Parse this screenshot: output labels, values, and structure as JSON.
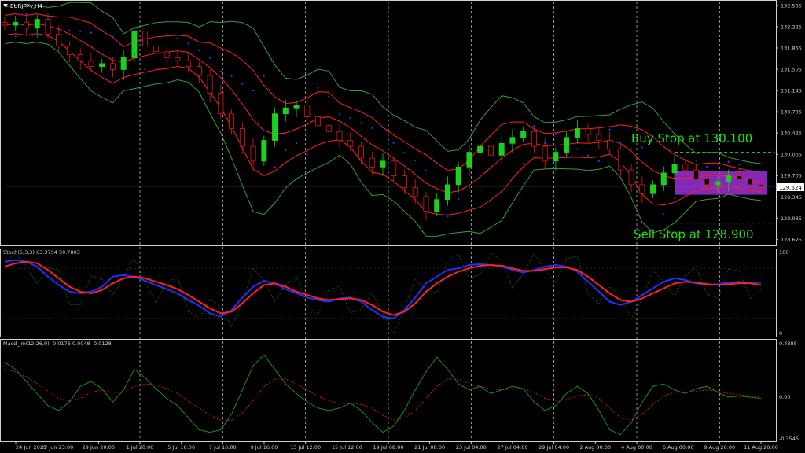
{
  "chart_data": {
    "type": "line",
    "symbol_title": "EURJPYy,H4",
    "annotations": {
      "buy_stop": "Buy Stop at 130.100",
      "sell_stop": "Sell Stop at 128.900",
      "annotation_color": "#19e019"
    },
    "current_price": "129.524",
    "current_price_value": 129.524,
    "price_axis": {
      "min": 128.55,
      "max": 132.65,
      "ticks": [
        "132.585",
        "132.225",
        "131.865",
        "131.505",
        "131.145",
        "130.785",
        "130.425",
        "130.065",
        "129.705",
        "129.345",
        "128.985",
        "128.625"
      ],
      "tick_values": [
        132.585,
        132.225,
        131.865,
        131.505,
        131.145,
        130.785,
        130.425,
        130.065,
        129.705,
        129.345,
        128.985,
        128.625
      ]
    },
    "x_ticks": [
      "24 Jun 2021",
      "27 Jun 23:00",
      "29 Jun 20:00",
      "1 Jul 20:00",
      "5 Jul 16:00",
      "7 Jul 16:00",
      "9 Jul 16:00",
      "13 Jul 12:00",
      "15 Jul 12:00",
      "19 Jul 08:00",
      "21 Jul 08:00",
      "23 Jul 04:00",
      "27 Jul 04:00",
      "29 Jul 04:00",
      "2 Aug 00:00",
      "4 Aug 00:00",
      "6 Aug 00:00",
      "9 Aug 20:00",
      "11 Aug 20:00"
    ],
    "close_series": {
      "name": "EURJPY close",
      "values": [
        132.25,
        132.3,
        132.2,
        132.35,
        132.1,
        131.9,
        131.75,
        131.65,
        131.55,
        131.6,
        131.5,
        131.7,
        132.15,
        131.9,
        131.8,
        131.7,
        131.65,
        131.55,
        131.4,
        131.1,
        130.75,
        130.5,
        130.2,
        129.95,
        130.3,
        130.75,
        130.85,
        130.9,
        130.7,
        130.55,
        130.45,
        130.3,
        130.2,
        130.0,
        129.85,
        129.95,
        129.7,
        129.5,
        129.35,
        129.1,
        129.3,
        129.55,
        129.85,
        130.1,
        130.2,
        130.05,
        130.25,
        130.35,
        130.45,
        130.2,
        129.95,
        130.1,
        130.35,
        130.5,
        130.4,
        130.3,
        130.15,
        129.8,
        129.55,
        129.4,
        129.55,
        129.75,
        129.9,
        129.8,
        129.65,
        129.55,
        129.6,
        129.7,
        129.65,
        129.55,
        129.52
      ],
      "color": "#19c819"
    },
    "bollinger": {
      "upper_color": "#3c9b3c",
      "middle_color": "#ff2020",
      "psar_color": "#2a3dff"
    },
    "current_price_line": "#8a8a8a",
    "highlight_box_color": "#9a2fd8",
    "stochastic": {
      "label": "Stoch(5,3,3) 63.3754 59.7803",
      "axis_max": "100",
      "axis_min": "0",
      "main_color": "#2030ff",
      "signal_color": "#ff2020",
      "dotted_color": "#1a6e1a",
      "main": [
        88,
        90,
        88,
        82,
        70,
        60,
        52,
        50,
        52,
        58,
        70,
        72,
        70,
        65,
        60,
        55,
        50,
        42,
        35,
        26,
        22,
        30,
        45,
        58,
        65,
        62,
        55,
        50,
        45,
        42,
        40,
        44,
        45,
        40,
        30,
        22,
        20,
        30,
        45,
        62,
        70,
        78,
        80,
        84,
        85,
        84,
        82,
        78,
        75,
        78,
        82,
        84,
        82,
        76,
        64,
        52,
        40,
        36,
        40,
        48,
        56,
        64,
        68,
        66,
        62,
        60,
        61,
        63,
        64,
        63,
        63
      ],
      "signal": [
        82,
        86,
        88,
        86,
        78,
        68,
        58,
        52,
        50,
        54,
        62,
        68,
        70,
        68,
        64,
        60,
        55,
        48,
        40,
        32,
        26,
        28,
        38,
        50,
        60,
        62,
        58,
        52,
        48,
        44,
        42,
        43,
        44,
        42,
        36,
        28,
        24,
        28,
        38,
        52,
        62,
        70,
        76,
        80,
        83,
        84,
        83,
        80,
        77,
        77,
        79,
        81,
        81,
        78,
        70,
        60,
        50,
        42,
        40,
        44,
        50,
        56,
        62,
        64,
        63,
        61,
        60,
        61,
        62,
        62,
        60
      ]
    },
    "macd": {
      "label": "Macd_Jm(12,26,9) -0.0176 0.0048 -0.0128",
      "axis_top": "0.4385",
      "axis_zero": "0.00",
      "axis_bottom": "-0.3545",
      "axis_top_value": 0.4385,
      "axis_bottom_value": -0.3545,
      "main_color": "#1f8a1f",
      "signal_color": "#c81e1e",
      "main": [
        0.28,
        0.22,
        0.12,
        0.02,
        -0.08,
        -0.12,
        -0.05,
        0.08,
        0.12,
        0.06,
        -0.05,
        0.05,
        0.22,
        0.15,
        0.06,
        -0.02,
        -0.08,
        -0.18,
        -0.28,
        -0.3,
        -0.28,
        -0.15,
        0.05,
        0.25,
        0.34,
        0.22,
        0.1,
        0.02,
        -0.05,
        -0.1,
        -0.12,
        -0.1,
        -0.06,
        -0.12,
        -0.22,
        -0.3,
        -0.25,
        -0.12,
        0.05,
        0.2,
        0.32,
        0.22,
        0.1,
        0.05,
        0.08,
        0.02,
        0.05,
        0.08,
        0.06,
        -0.05,
        -0.12,
        -0.08,
        0.02,
        0.08,
        0.02,
        -0.12,
        -0.28,
        -0.32,
        -0.22,
        -0.05,
        0.08,
        0.1,
        0.05,
        0.02,
        0.06,
        0.08,
        0.03,
        -0.01,
        0.0,
        -0.01,
        -0.02
      ],
      "signal": [
        0.22,
        0.2,
        0.16,
        0.1,
        0.04,
        -0.02,
        -0.04,
        -0.02,
        0.03,
        0.05,
        0.03,
        0.03,
        0.08,
        0.1,
        0.09,
        0.06,
        0.02,
        -0.04,
        -0.1,
        -0.16,
        -0.2,
        -0.2,
        -0.14,
        -0.04,
        0.08,
        0.14,
        0.14,
        0.1,
        0.05,
        0.0,
        -0.04,
        -0.06,
        -0.06,
        -0.07,
        -0.1,
        -0.16,
        -0.2,
        -0.18,
        -0.12,
        -0.02,
        0.08,
        0.14,
        0.14,
        0.1,
        0.08,
        0.06,
        0.05,
        0.06,
        0.06,
        0.03,
        -0.02,
        -0.04,
        -0.03,
        0.0,
        0.01,
        -0.02,
        -0.1,
        -0.18,
        -0.2,
        -0.15,
        -0.07,
        0.0,
        0.03,
        0.03,
        0.04,
        0.05,
        0.04,
        0.02,
        0.01,
        0.0,
        -0.01
      ]
    }
  }
}
